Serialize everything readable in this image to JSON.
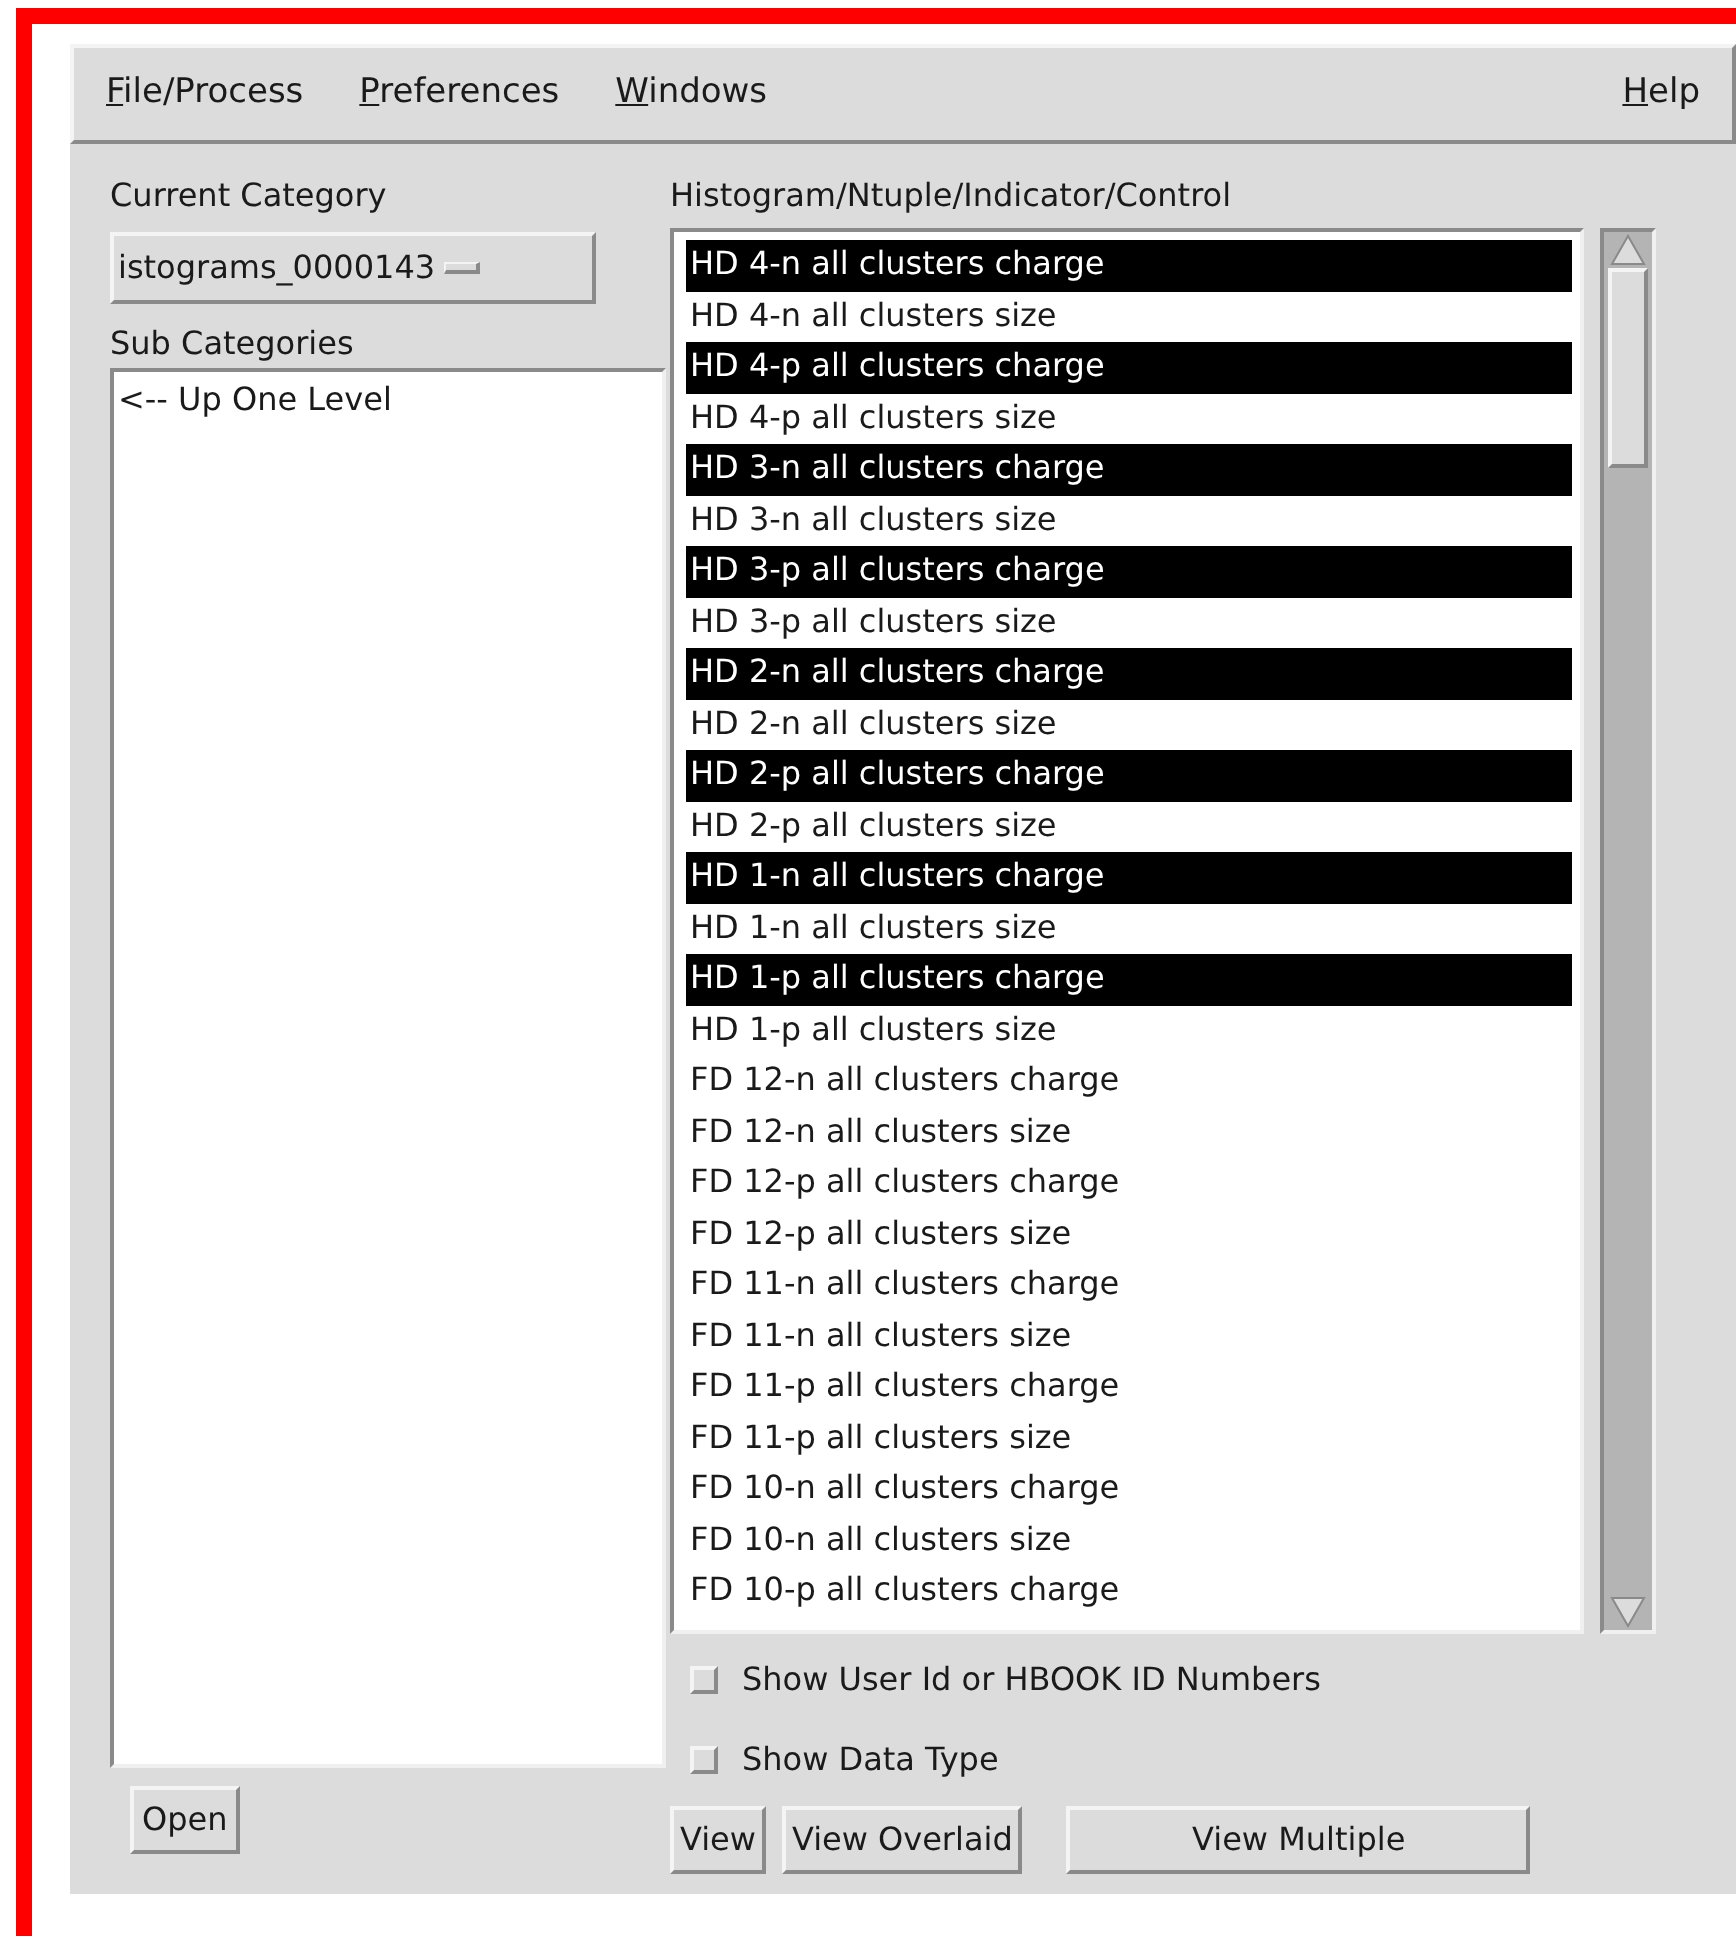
{
  "menu_bar": {
    "left": [
      "File/Process",
      "Preferences",
      "Windows"
    ],
    "right": "Help"
  },
  "left_panel": {
    "current_category_label": "Current Category",
    "current_category": "istograms_0000143",
    "sub_categories_label": "Sub Categories",
    "sub_categories": [
      {
        "label": "<-- Up One Level",
        "selected": false
      }
    ],
    "open_button": "Open"
  },
  "right_panel": {
    "list_label": "Histogram/Ntuple/Indicator/Control",
    "items": [
      {
        "label": "HD 4-n all clusters charge",
        "selected": true
      },
      {
        "label": "HD 4-n all clusters size",
        "selected": false
      },
      {
        "label": "HD 4-p all clusters charge",
        "selected": true
      },
      {
        "label": "HD 4-p all clusters size",
        "selected": false
      },
      {
        "label": "HD 3-n all clusters charge",
        "selected": true
      },
      {
        "label": "HD 3-n all clusters size",
        "selected": false
      },
      {
        "label": "HD 3-p all clusters charge",
        "selected": true
      },
      {
        "label": "HD 3-p all clusters size",
        "selected": false
      },
      {
        "label": "HD 2-n all clusters charge",
        "selected": true
      },
      {
        "label": "HD 2-n all clusters size",
        "selected": false
      },
      {
        "label": "HD 2-p all clusters charge",
        "selected": true
      },
      {
        "label": "HD 2-p all clusters size",
        "selected": false
      },
      {
        "label": "HD 1-n all clusters charge",
        "selected": true
      },
      {
        "label": "HD 1-n all clusters size",
        "selected": false
      },
      {
        "label": "HD 1-p all clusters charge",
        "selected": true
      },
      {
        "label": "HD 1-p all clusters size",
        "selected": false
      },
      {
        "label": "FD 12-n all clusters charge",
        "selected": false
      },
      {
        "label": "FD 12-n all clusters size",
        "selected": false
      },
      {
        "label": "FD 12-p all clusters charge",
        "selected": false
      },
      {
        "label": "FD 12-p all clusters size",
        "selected": false
      },
      {
        "label": "FD 11-n all clusters charge",
        "selected": false
      },
      {
        "label": "FD 11-n all clusters size",
        "selected": false
      },
      {
        "label": "FD 11-p all clusters charge",
        "selected": false
      },
      {
        "label": "FD 11-p all clusters size",
        "selected": false
      },
      {
        "label": "FD 10-n all clusters charge",
        "selected": false
      },
      {
        "label": "FD 10-n all clusters size",
        "selected": false
      },
      {
        "label": "FD 10-p all clusters charge",
        "selected": false
      }
    ],
    "options": [
      {
        "label": "Show User Id or HBOOK ID Numbers",
        "checked": false
      },
      {
        "label": "Show Data Type",
        "checked": false
      }
    ],
    "buttons": [
      "View",
      "View Overlaid",
      "View Multiple"
    ]
  }
}
